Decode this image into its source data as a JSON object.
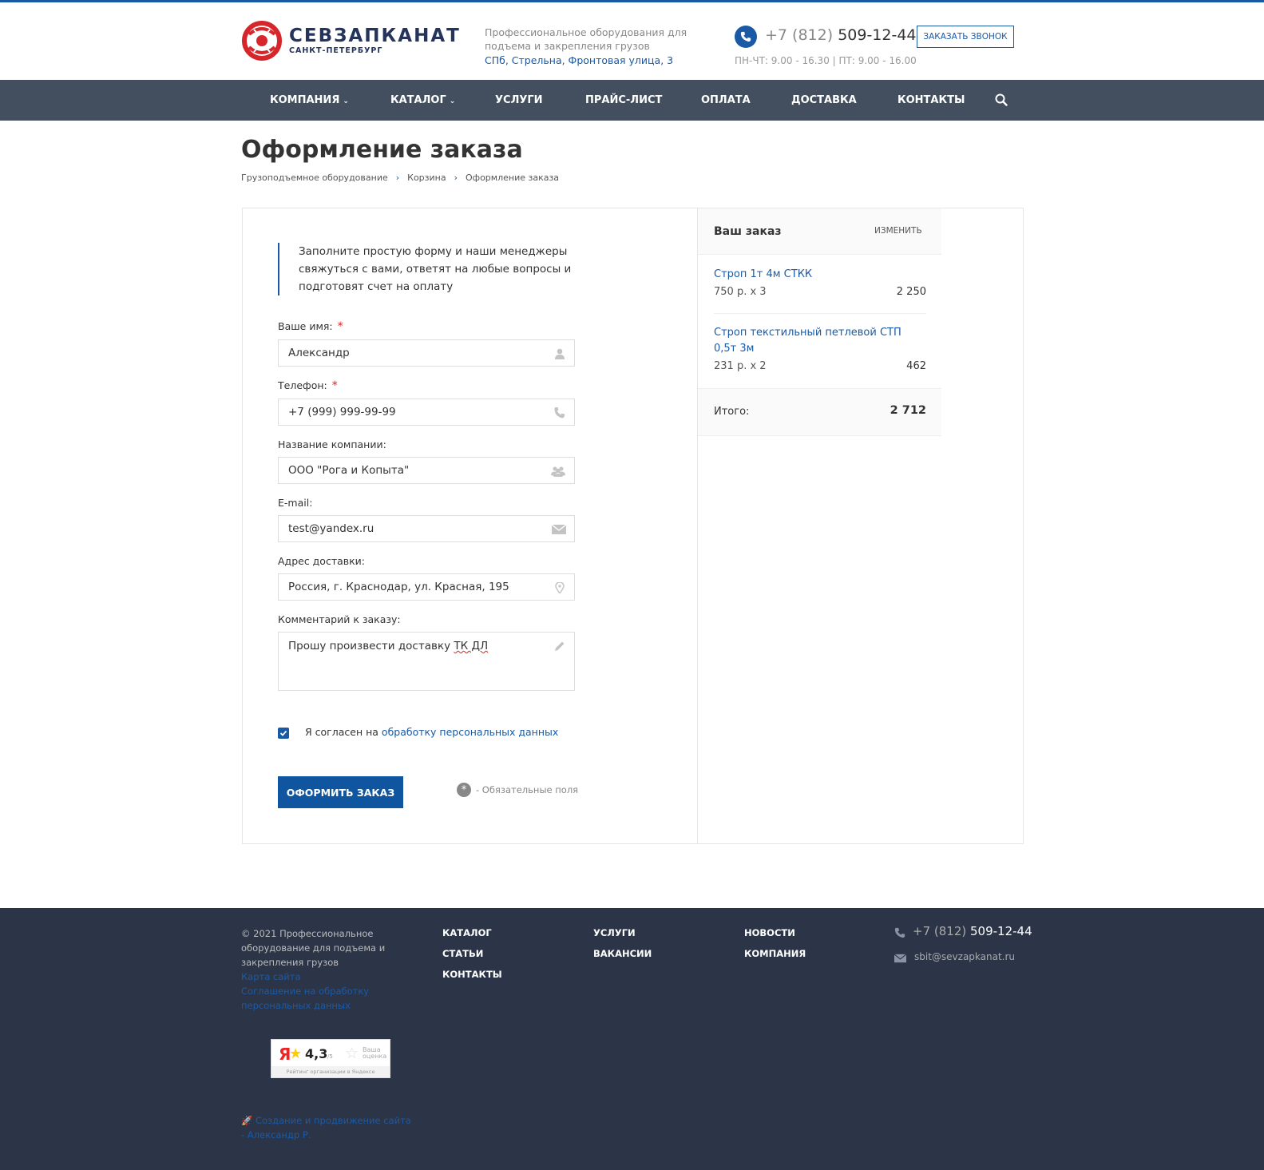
{
  "header": {
    "logo_title": "СЕВЗАПКАНАТ",
    "logo_sub": "САНКТ-ПЕТЕРБУРГ",
    "tagline": "Профессиональное оборудования для подъема и закрепления грузов",
    "address": "СПб, Стрельна, Фронтовая улица, 3",
    "phone_code": "+7 (812)",
    "phone_number": "509-12-44",
    "hours": "ПН-ЧТ: 9.00 - 16.30 | ПТ: 9.00 - 16.00",
    "callback_label": "ЗАКАЗАТЬ ЗВОНОК"
  },
  "nav": {
    "items": [
      {
        "label": "КОМПАНИЯ",
        "caret": "⌄"
      },
      {
        "label": "КАТАЛОГ",
        "caret": "⌄"
      },
      {
        "label": "УСЛУГИ"
      },
      {
        "label": "ПРАЙС-ЛИСТ"
      },
      {
        "label": "ОПЛАТА"
      },
      {
        "label": "ДОСТАВКА"
      },
      {
        "label": "КОНТАКТЫ"
      }
    ],
    "search_icon": "search-icon"
  },
  "page": {
    "title": "Оформление заказа",
    "breadcrumb": [
      "Грузоподъемное оборудование",
      "Корзина",
      "Оформление заказа"
    ]
  },
  "form": {
    "intro": "Заполните простую форму и наши менеджеры свяжуться с вами, ответят на любые вопросы и подготовят счет на оплату",
    "required_mark": "*",
    "fields": {
      "name": {
        "label": "Ваше имя:",
        "value": "Александр"
      },
      "phone": {
        "label": "Телефон:",
        "value": "+7 (999) 999-99-99"
      },
      "company": {
        "label": "Название компании:",
        "value": "ООО \"Рога и Копыта\""
      },
      "email": {
        "label": "E-mail:",
        "value": "test@yandex.ru"
      },
      "address": {
        "label": "Адрес доставки:",
        "value": "Россия, г. Краснодар, ул. Красная, 195"
      },
      "comment": {
        "label": "Комментарий к заказу:",
        "value_main": "Прошу произвести доставку ",
        "value_spell": "ТК ДЛ"
      }
    },
    "consent_text": "Я согласен на ",
    "consent_link": "обработку персональных данных",
    "consent_checked": true,
    "submit_label": "ОФОРМИТЬ ЗАКАЗ",
    "required_note": "- Обязательные поля"
  },
  "order": {
    "title": "Ваш заказ",
    "edit_label": "ИЗМЕНИТЬ",
    "items": [
      {
        "name": "Строп 1т 4м СТКК",
        "qty": "750 р. x 3",
        "sum": "2 250"
      },
      {
        "name": "Строп текстильный петлевой СТП 0,5т 3м",
        "qty": "231 р. x 2",
        "sum": "462"
      }
    ],
    "total_label": "Итого:",
    "total_value": "2 712"
  },
  "footer": {
    "copyright": "© 2021 Профессиональное оборудование для подъема и закрепления грузов",
    "sitemap": "Карта сайта",
    "agreement": "Соглашение на обработку персональных данных",
    "nav": [
      "КАТАЛОГ",
      "СТАТЬИ",
      "КОНТАКТЫ",
      "УСЛУГИ",
      "ВАКАНСИИ",
      "НОВОСТИ",
      "КОМПАНИЯ"
    ],
    "phone_code": "+7 (812)",
    "phone_number": "509-12-44",
    "email": "sbit@sevzapkanat.ru",
    "yandex": {
      "letter": "Я",
      "score": "4,3",
      "of": "/5",
      "your_rating": "Ваша оценка",
      "caption": "Рейтинг организации в Яндексе"
    },
    "dev": "Создание и продвижение сайта - Александр Р."
  },
  "colors": {
    "accent": "#1a5aa5",
    "nav_bg": "#434f5f",
    "footer_bg": "#2c3548",
    "required": "#dd2222"
  }
}
